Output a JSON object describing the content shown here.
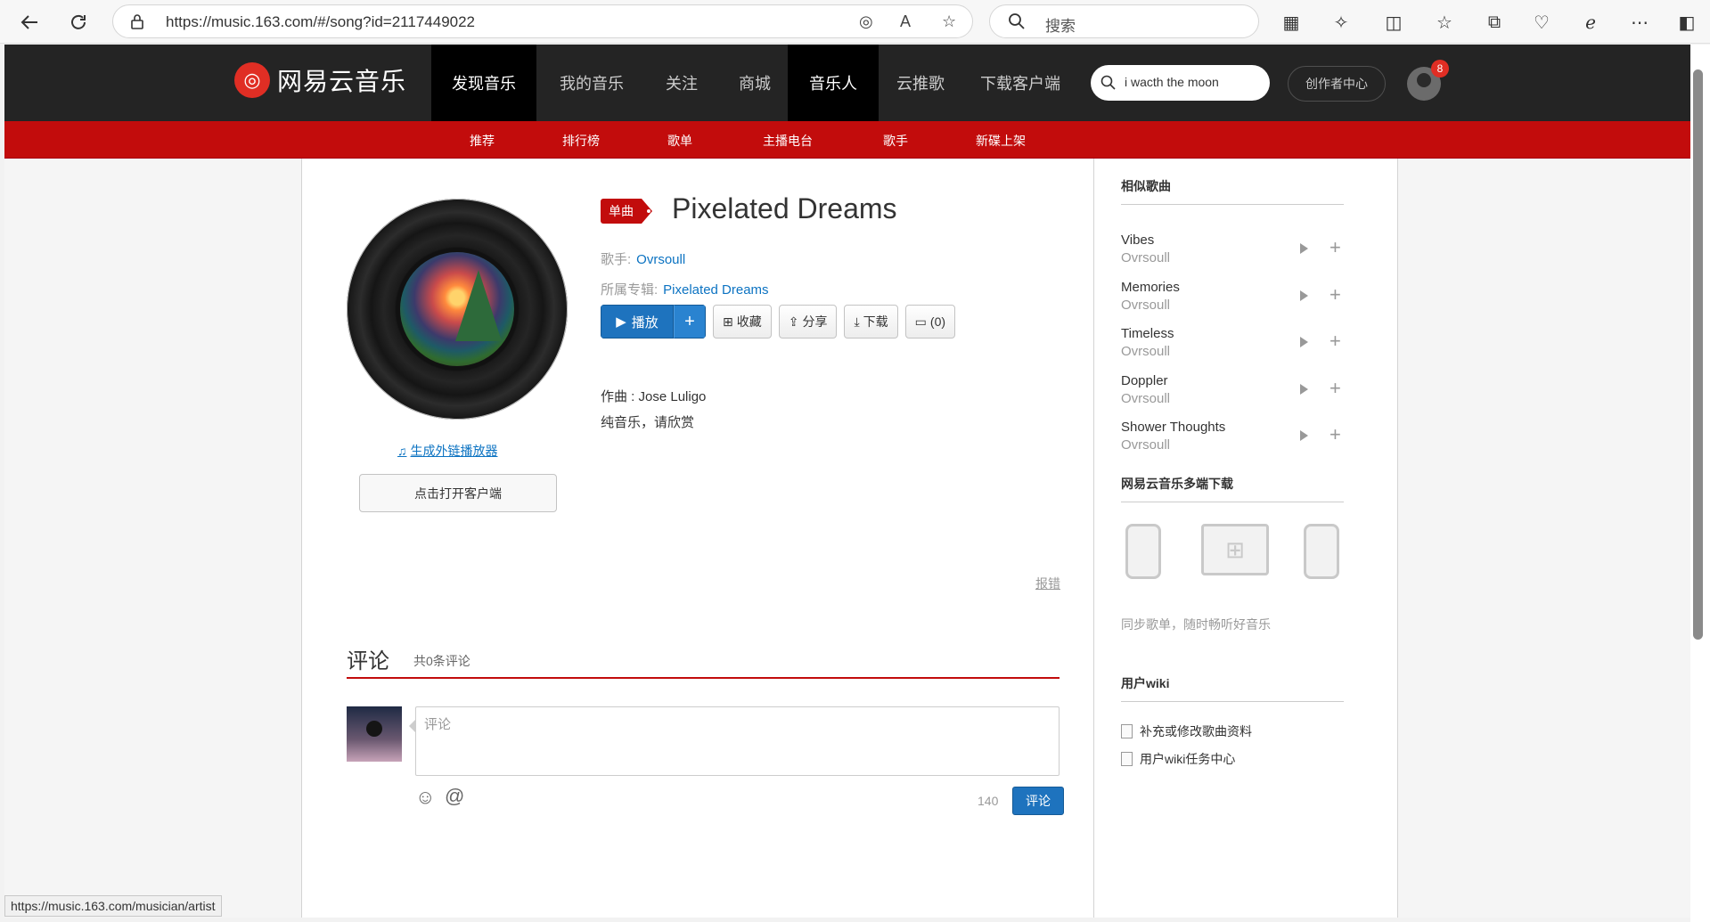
{
  "browser": {
    "url": "https://music.163.com/#/song?id=2117449022",
    "search_placeholder": "搜索"
  },
  "site": {
    "logo_text": "网易云音乐",
    "nav": [
      "发现音乐",
      "我的音乐",
      "关注",
      "商城",
      "音乐人",
      "云推歌",
      "下载客户端"
    ],
    "search_value": "i wacth the moon",
    "creator_label": "创作者中心",
    "notification_count": "8",
    "subnav": [
      "推荐",
      "排行榜",
      "歌单",
      "主播电台",
      "歌手",
      "新碟上架"
    ]
  },
  "song": {
    "tag": "单曲",
    "title": "Pixelated Dreams",
    "artist_label": "歌手:",
    "artist": "Ovrsoull",
    "album_label": "所属专辑:",
    "album": "Pixelated Dreams",
    "credit": "作曲 : Jose Luligo",
    "description": "纯音乐，请欣赏",
    "external_player_link": "生成外链播放器",
    "open_client": "点击打开客户端",
    "report": "报错"
  },
  "actions": {
    "play": "播放",
    "add": "+",
    "collect": "收藏",
    "share": "分享",
    "download": "下载",
    "comment_count": "(0)"
  },
  "comments": {
    "heading": "评论",
    "total": "共0条评论",
    "placeholder": "评论",
    "remaining": "140",
    "submit": "评论"
  },
  "sidebar": {
    "similar_title": "相似歌曲",
    "similar": [
      {
        "name": "Vibes",
        "artist": "Ovrsoull"
      },
      {
        "name": "Memories",
        "artist": "Ovrsoull"
      },
      {
        "name": "Timeless",
        "artist": "Ovrsoull"
      },
      {
        "name": "Doppler",
        "artist": "Ovrsoull"
      },
      {
        "name": "Shower Thoughts",
        "artist": "Ovrsoull"
      }
    ],
    "download_title": "网易云音乐多端下载",
    "sync_text": "同步歌单，随时畅听好音乐",
    "wiki_title": "用户wiki",
    "wiki_items": [
      "补充或修改歌曲资料",
      "用户wiki任务中心"
    ]
  },
  "status_url": "https://music.163.com/musician/artist",
  "colors": {
    "brand_red": "#c20c0c",
    "link_blue": "#0c73c2",
    "button_blue": "#1e73be",
    "nav_dark": "#242424"
  }
}
